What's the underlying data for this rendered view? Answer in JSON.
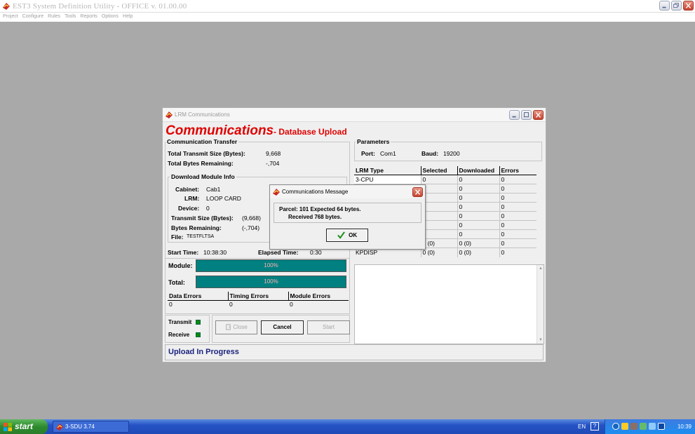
{
  "app": {
    "title": "EST3 System Definition Utility - OFFICE v. 01.00.00",
    "menu": [
      "Project",
      "Configure",
      "Rules",
      "Tools",
      "Reports",
      "Options",
      "Help"
    ]
  },
  "lrm_window": {
    "title": "LRM Communications",
    "header_title": "Communications",
    "header_subtitle": "- Database Upload",
    "transfer": {
      "group_label": "Communication Transfer",
      "total_transmit_label": "Total Transmit Size (Bytes):",
      "total_transmit_value": "9,668",
      "total_remaining_label": "Total Bytes Remaining:",
      "total_remaining_value": "-,704"
    },
    "module_info": {
      "group_label": "Download Module Info",
      "cabinet_label": "Cabinet:",
      "cabinet_value": "Cab1",
      "lrm_label": "LRM:",
      "lrm_value": "LOOP  CARD",
      "device_label": "Device:",
      "device_value": "0",
      "transmit_size_label": "Transmit Size (Bytes):",
      "transmit_size_value": "(9,668)",
      "bytes_remaining_label": "Bytes Remaining:",
      "bytes_remaining_value": "(-,704)",
      "file_label": "File:",
      "file_value": "TESTFLTSA"
    },
    "timing": {
      "start_label": "Start Time:",
      "start_value": "10:38:30",
      "elapsed_label": "Elapsed Time:",
      "elapsed_value": "0:30"
    },
    "progress": {
      "module_label": "Module:",
      "module_text": "100%",
      "module_fraction": 1.0,
      "total_label": "Total:",
      "total_text": "100%",
      "total_fraction": 1.0
    },
    "errors": {
      "headers": [
        "Data Errors",
        "Timing Errors",
        "Module Errors"
      ],
      "values": [
        "0",
        "0",
        "0"
      ]
    },
    "indicators": {
      "transmit_label": "Transmit",
      "receive_label": "Receive"
    },
    "buttons": {
      "close": "Close",
      "cancel": "Cancel",
      "start": "Start"
    },
    "parameters": {
      "group_label": "Parameters",
      "port_label": "Port:",
      "port_value": "Com1",
      "baud_label": "Baud:",
      "baud_value": "19200"
    },
    "lrm_table": {
      "headers": [
        "LRM Type",
        "Selected",
        "Downloaded",
        "Errors"
      ],
      "rows": [
        [
          "3-CPU",
          "0",
          "0",
          "0"
        ],
        [
          "",
          "0",
          "0",
          "0"
        ],
        [
          "",
          "0",
          "0",
          "0"
        ],
        [
          "",
          "0",
          "0",
          "0"
        ],
        [
          "",
          "0",
          "0",
          "0"
        ],
        [
          "",
          "0",
          "0",
          "0"
        ],
        [
          "",
          "0",
          "0",
          "0"
        ],
        [
          "",
          "0 (0)",
          "0 (0)",
          "0"
        ],
        [
          "KPDISP",
          "0 (0)",
          "0 (0)",
          "0"
        ]
      ]
    },
    "status": "Upload In Progress"
  },
  "message_box": {
    "title": "Communications Message",
    "line1": "Parcel: 101  Expected 64 bytes.",
    "line2": "Received 768 bytes.",
    "ok_label": "OK"
  },
  "taskbar": {
    "start_label": "start",
    "task_label": "3-SDU 3.74",
    "lang": "EN",
    "help": "?",
    "clock": "10:39"
  }
}
